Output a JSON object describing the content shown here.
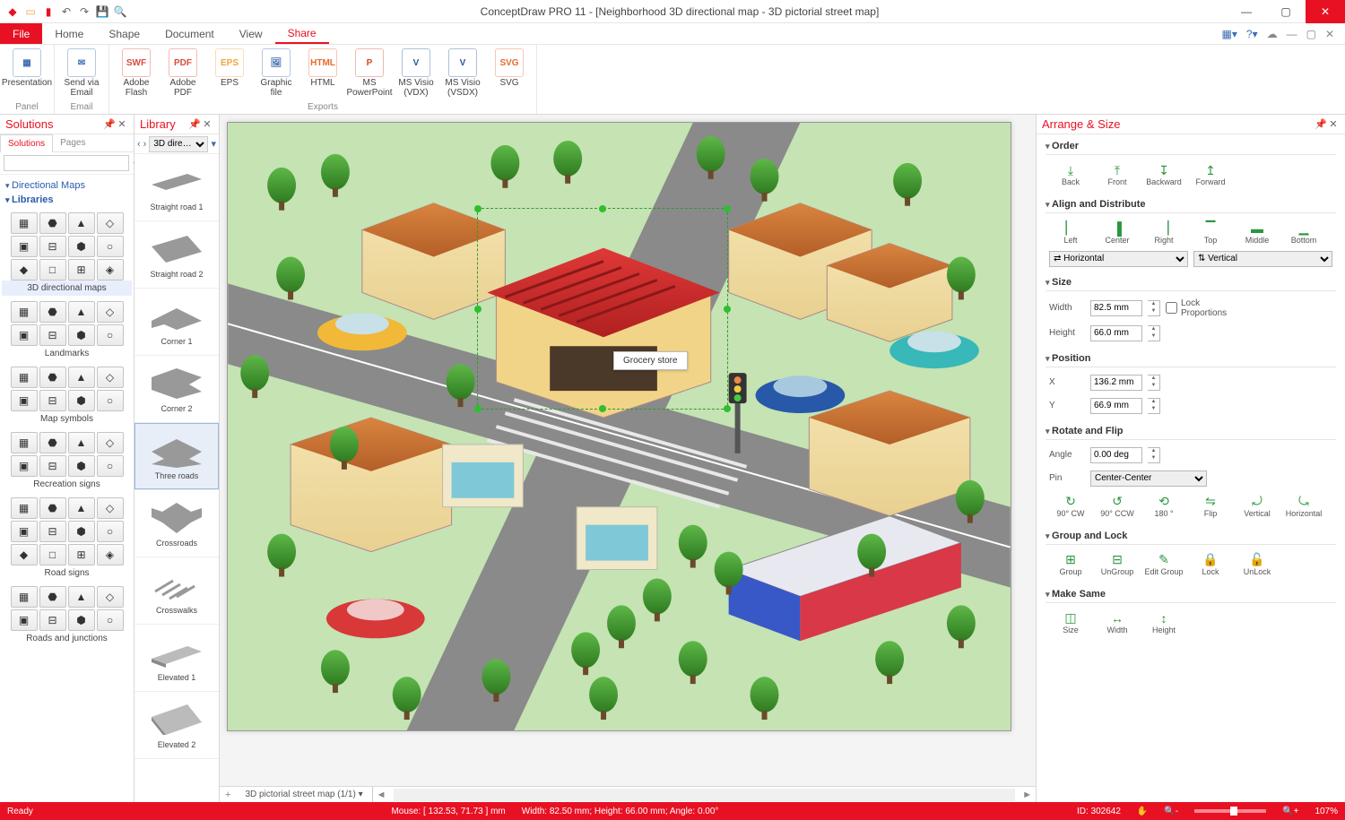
{
  "window": {
    "title": "ConceptDraw PRO 11 - [Neighborhood 3D directional map - 3D pictorial street map]"
  },
  "ribbon": {
    "file": "File",
    "tabs": [
      "Home",
      "Shape",
      "Document",
      "View",
      "Share"
    ],
    "active": "Share",
    "groups": {
      "panel": {
        "name": "Panel",
        "items": [
          {
            "label": "Presentation",
            "ic": "▦",
            "c": "#3b6db3"
          }
        ]
      },
      "email": {
        "name": "Email",
        "items": [
          {
            "label": "Send via Email",
            "ic": "✉",
            "c": "#3b6db3"
          }
        ]
      },
      "exports": {
        "name": "Exports",
        "items": [
          {
            "label": "Adobe Flash",
            "ic": "SWF",
            "c": "#d94c3d"
          },
          {
            "label": "Adobe PDF",
            "ic": "PDF",
            "c": "#d94c3d"
          },
          {
            "label": "EPS",
            "ic": "EPS",
            "c": "#f2a33a"
          },
          {
            "label": "Graphic file",
            "ic": "🖼",
            "c": "#3b6db3"
          },
          {
            "label": "HTML",
            "ic": "HTML",
            "c": "#e86a2e"
          },
          {
            "label": "MS PowerPoint",
            "ic": "P",
            "c": "#d24726"
          },
          {
            "label": "MS Visio (VDX)",
            "ic": "V",
            "c": "#2b579a"
          },
          {
            "label": "MS Visio (VSDX)",
            "ic": "V",
            "c": "#2b579a"
          },
          {
            "label": "SVG",
            "ic": "SVG",
            "c": "#e86a2e"
          }
        ]
      }
    }
  },
  "solutions": {
    "title": "Solutions",
    "tabs": [
      "Solutions",
      "Pages"
    ],
    "tree": [
      "Directional Maps",
      "Libraries"
    ],
    "groups": [
      {
        "label": "3D directional maps",
        "sel": true
      },
      {
        "label": "Landmarks"
      },
      {
        "label": "Map symbols"
      },
      {
        "label": "Recreation signs"
      },
      {
        "label": "Road signs"
      },
      {
        "label": "Roads and junctions"
      }
    ]
  },
  "library": {
    "title": "Library",
    "dropdown": "3D dire…",
    "items": [
      {
        "label": "Straight road 1"
      },
      {
        "label": "Straight road 2"
      },
      {
        "label": "Corner 1"
      },
      {
        "label": "Corner 2"
      },
      {
        "label": "Three roads",
        "sel": true
      },
      {
        "label": "Crossroads"
      },
      {
        "label": "Crosswalks"
      },
      {
        "label": "Elevated 1"
      },
      {
        "label": "Elevated 2"
      }
    ]
  },
  "canvas": {
    "tooltip": "Grocery store",
    "doc_tab": "3D pictorial street map (1/1)"
  },
  "arrange": {
    "title": "Arrange & Size",
    "order": {
      "hdr": "Order",
      "btns": [
        "Back",
        "Front",
        "Backward",
        "Forward"
      ]
    },
    "align": {
      "hdr": "Align and Distribute",
      "btns": [
        "Left",
        "Center",
        "Right",
        "Top",
        "Middle",
        "Bottom"
      ],
      "h_sel": "Horizontal",
      "v_sel": "Vertical"
    },
    "size": {
      "hdr": "Size",
      "w_lbl": "Width",
      "h_lbl": "Height",
      "w": "82.5 mm",
      "h": "66.0 mm",
      "lock": "Lock Proportions"
    },
    "pos": {
      "hdr": "Position",
      "x_lbl": "X",
      "y_lbl": "Y",
      "x": "136.2 mm",
      "y": "66.9 mm"
    },
    "rot": {
      "hdr": "Rotate and Flip",
      "ang_lbl": "Angle",
      "ang": "0.00 deg",
      "pin_lbl": "Pin",
      "pin": "Center-Center",
      "btns": [
        "90° CW",
        "90° CCW",
        "180 °",
        "Flip",
        "Vertical",
        "Horizontal"
      ]
    },
    "grp": {
      "hdr": "Group and Lock",
      "btns": [
        "Group",
        "UnGroup",
        "Edit Group",
        "Lock",
        "UnLock"
      ]
    },
    "same": {
      "hdr": "Make Same",
      "btns": [
        "Size",
        "Width",
        "Height"
      ]
    }
  },
  "status": {
    "ready": "Ready",
    "mouse": "Mouse: [ 132.53, 71.73 ] mm",
    "dims": "Width: 82.50 mm;   Height: 66.00 mm;   Angle: 0.00°",
    "id": "ID: 302642",
    "zoom": "107%"
  }
}
